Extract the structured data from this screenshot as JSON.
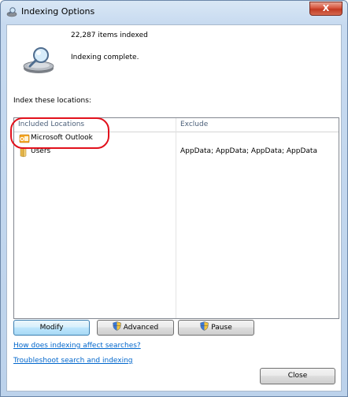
{
  "window": {
    "title": "Indexing Options",
    "close_label": "X"
  },
  "status": {
    "items_indexed": "22,287 items indexed",
    "state": "Indexing complete."
  },
  "locations": {
    "label": "Index these locations:",
    "columns": {
      "included": "Included Locations",
      "exclude": "Exclude"
    },
    "rows": [
      {
        "name": "Microsoft Outlook",
        "exclude": "",
        "icon": "outlook-icon"
      },
      {
        "name": "Users",
        "exclude": "AppData; AppData; AppData; AppData",
        "icon": "folder-icon"
      }
    ]
  },
  "buttons": {
    "modify": "Modify",
    "advanced": "Advanced",
    "pause": "Pause",
    "close": "Close"
  },
  "links": {
    "how_indexing": "How does indexing affect searches?",
    "troubleshoot": "Troubleshoot search and indexing"
  },
  "colors": {
    "highlight": "#e2111c",
    "link": "#0066cc"
  }
}
